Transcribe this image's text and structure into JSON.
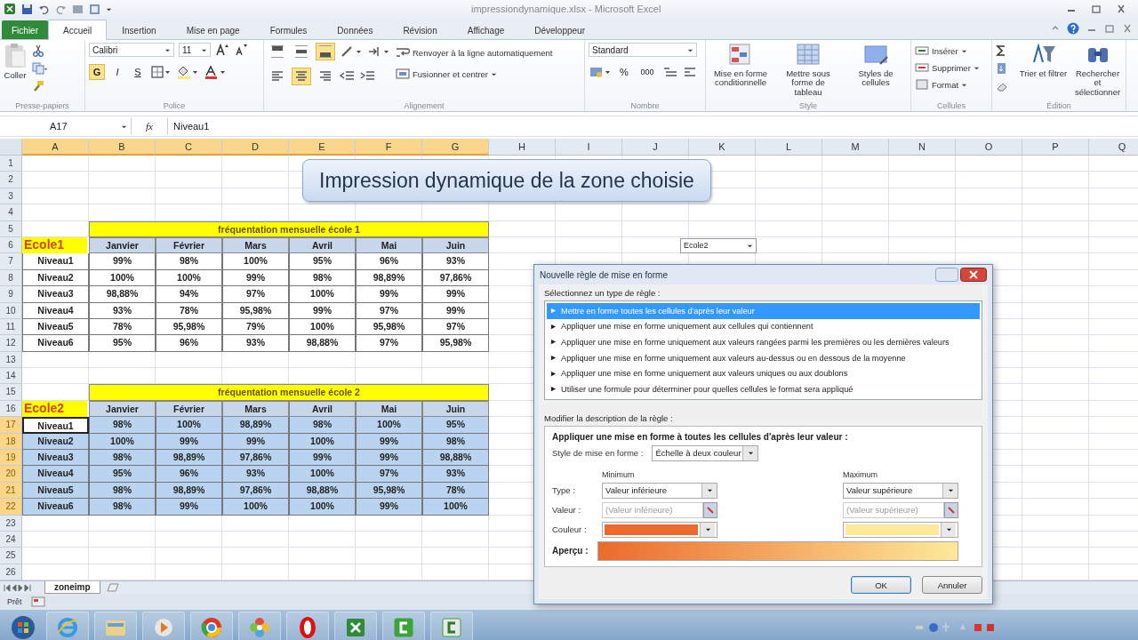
{
  "window": {
    "title": "impressiondynamique.xlsx - Microsoft Excel"
  },
  "tabs": [
    {
      "label": "Fichier",
      "kind": "file",
      "selected": false
    },
    {
      "label": "Accueil",
      "kind": "tab",
      "selected": true
    },
    {
      "label": "Insertion",
      "kind": "tab",
      "selected": false
    },
    {
      "label": "Mise en page",
      "kind": "tab",
      "selected": false
    },
    {
      "label": "Formules",
      "kind": "tab",
      "selected": false
    },
    {
      "label": "Données",
      "kind": "tab",
      "selected": false
    },
    {
      "label": "Révision",
      "kind": "tab",
      "selected": false
    },
    {
      "label": "Affichage",
      "kind": "tab",
      "selected": false
    },
    {
      "label": "Développeur",
      "kind": "tab",
      "selected": false
    }
  ],
  "ribbon": {
    "clipboard": {
      "label": "Presse-papiers",
      "paste": "Coller"
    },
    "font": {
      "label": "Police",
      "name": "Calibri",
      "size": "11",
      "styles": [
        {
          "label": "G",
          "kind": "bold",
          "selected": true
        },
        {
          "label": "I",
          "kind": "italic",
          "selected": false
        },
        {
          "label": "S",
          "kind": "underline",
          "selected": false
        }
      ]
    },
    "alignment": {
      "label": "Alignement",
      "vertical": [
        {
          "kind": "top",
          "selected": false
        },
        {
          "kind": "middle",
          "selected": false
        },
        {
          "kind": "bottom",
          "selected": true
        }
      ],
      "horizontal": [
        {
          "kind": "left",
          "selected": false
        },
        {
          "kind": "center",
          "selected": true
        },
        {
          "kind": "right",
          "selected": false
        }
      ],
      "wrap": "Renvoyer à la ligne automatiquement",
      "merge": "Fusionner et centrer"
    },
    "number": {
      "label": "Nombre",
      "format": "Standard",
      "percent": "%",
      "thousands": "000"
    },
    "style": {
      "label": "Style",
      "buttons": [
        "Mise en forme conditionnelle",
        "Mettre sous forme de tableau",
        "Styles de cellules"
      ]
    },
    "cells": {
      "label": "Cellules",
      "buttons": [
        "Insérer",
        "Supprimer",
        "Format"
      ]
    },
    "editing": {
      "label": "Édition",
      "buttons": [
        "Trier et filtrer",
        "Rechercher et sélectionner"
      ]
    }
  },
  "formula_bar": {
    "name_box": "A17",
    "fx": "fx",
    "value": "Niveau1"
  },
  "sheet": {
    "columns": [
      {
        "label": "A",
        "selected": true
      },
      {
        "label": "B",
        "selected": true
      },
      {
        "label": "C",
        "selected": true
      },
      {
        "label": "D",
        "selected": true
      },
      {
        "label": "E",
        "selected": true
      },
      {
        "label": "F",
        "selected": true
      },
      {
        "label": "G",
        "selected": true
      },
      {
        "label": "H",
        "selected": false
      },
      {
        "label": "I",
        "selected": false
      },
      {
        "label": "J",
        "selected": false
      },
      {
        "label": "K",
        "selected": false
      },
      {
        "label": "L",
        "selected": false
      },
      {
        "label": "M",
        "selected": false
      },
      {
        "label": "N",
        "selected": false
      },
      {
        "label": "O",
        "selected": false
      },
      {
        "label": "P",
        "selected": false
      },
      {
        "label": "Q",
        "selected": false
      }
    ],
    "row_numbers": [
      {
        "label": "1",
        "selected": false
      },
      {
        "label": "2",
        "selected": false
      },
      {
        "label": "3",
        "selected": false
      },
      {
        "label": "4",
        "selected": false
      },
      {
        "label": "5",
        "selected": false
      },
      {
        "label": "6",
        "selected": false
      },
      {
        "label": "7",
        "selected": false
      },
      {
        "label": "8",
        "selected": false
      },
      {
        "label": "9",
        "selected": false
      },
      {
        "label": "10",
        "selected": false
      },
      {
        "label": "11",
        "selected": false
      },
      {
        "label": "12",
        "selected": false
      },
      {
        "label": "13",
        "selected": false
      },
      {
        "label": "14",
        "selected": false
      },
      {
        "label": "15",
        "selected": false
      },
      {
        "label": "16",
        "selected": false
      },
      {
        "label": "17",
        "selected": true
      },
      {
        "label": "18",
        "selected": true
      },
      {
        "label": "19",
        "selected": true
      },
      {
        "label": "20",
        "selected": true
      },
      {
        "label": "21",
        "selected": true
      },
      {
        "label": "22",
        "selected": true
      },
      {
        "label": "23",
        "selected": false
      },
      {
        "label": "24",
        "selected": false
      },
      {
        "label": "25",
        "selected": false
      },
      {
        "label": "26",
        "selected": false
      }
    ],
    "title_shape": "Impression dynamique de la zone choisie",
    "selector": {
      "value": "Ecole2"
    },
    "tables": [
      {
        "title": "fréquentation mensuelle école 1",
        "school": "Ecole1",
        "months": [
          "Janvier",
          "Février",
          "Mars",
          "Avril",
          "Mai",
          "Juin"
        ],
        "rows": [
          {
            "label": "Niveau1",
            "selected": false,
            "active": false,
            "values": [
              "99%",
              "98%",
              "100%",
              "95%",
              "96%",
              "93%"
            ]
          },
          {
            "label": "Niveau2",
            "selected": false,
            "active": false,
            "values": [
              "100%",
              "100%",
              "99%",
              "98%",
              "98,89%",
              "97,86%"
            ]
          },
          {
            "label": "Niveau3",
            "selected": false,
            "active": false,
            "values": [
              "98,88%",
              "94%",
              "97%",
              "100%",
              "99%",
              "99%"
            ]
          },
          {
            "label": "Niveau4",
            "selected": false,
            "active": false,
            "values": [
              "93%",
              "78%",
              "95,98%",
              "99%",
              "97%",
              "99%"
            ]
          },
          {
            "label": "Niveau5",
            "selected": false,
            "active": false,
            "values": [
              "78%",
              "95,98%",
              "79%",
              "100%",
              "95,98%",
              "97%"
            ]
          },
          {
            "label": "Niveau6",
            "selected": false,
            "active": false,
            "values": [
              "95%",
              "96%",
              "93%",
              "98,88%",
              "97%",
              "95,98%"
            ]
          }
        ]
      },
      {
        "title": "fréquentation mensuelle école 2",
        "school": "Ecole2",
        "months": [
          "Janvier",
          "Février",
          "Mars",
          "Avril",
          "Mai",
          "Juin"
        ],
        "rows": [
          {
            "label": "Niveau1",
            "selected": true,
            "active": true,
            "values": [
              "98%",
              "100%",
              "98,89%",
              "98%",
              "100%",
              "95%"
            ]
          },
          {
            "label": "Niveau2",
            "selected": true,
            "active": false,
            "values": [
              "100%",
              "99%",
              "99%",
              "100%",
              "99%",
              "98%"
            ]
          },
          {
            "label": "Niveau3",
            "selected": true,
            "active": false,
            "values": [
              "98%",
              "98,89%",
              "97,86%",
              "99%",
              "99%",
              "98,88%"
            ]
          },
          {
            "label": "Niveau4",
            "selected": true,
            "active": false,
            "values": [
              "95%",
              "96%",
              "93%",
              "100%",
              "97%",
              "93%"
            ]
          },
          {
            "label": "Niveau5",
            "selected": true,
            "active": false,
            "values": [
              "98%",
              "98,89%",
              "97,86%",
              "98,88%",
              "95,98%",
              "78%"
            ]
          },
          {
            "label": "Niveau6",
            "selected": true,
            "active": false,
            "values": [
              "98%",
              "99%",
              "100%",
              "100%",
              "99%",
              "100%"
            ]
          }
        ]
      }
    ]
  },
  "sheet_tabs": [
    {
      "label": "zoneimp",
      "selected": true
    }
  ],
  "status_bar": {
    "text": "Prêt"
  },
  "dialog": {
    "title": "Nouvelle règle de mise en forme",
    "select_label": "Sélectionnez un type de règle :",
    "rules": [
      {
        "label": "Mettre en forme toutes les cellules d'après leur valeur",
        "selected": true
      },
      {
        "label": "Appliquer une mise en forme uniquement aux cellules qui contiennent",
        "selected": false
      },
      {
        "label": "Appliquer une mise en forme uniquement aux valeurs rangées parmi les premières ou les dernières valeurs",
        "selected": false
      },
      {
        "label": "Appliquer une mise en forme uniquement aux valeurs au-dessus ou en dessous de la moyenne",
        "selected": false
      },
      {
        "label": "Appliquer une mise en forme uniquement aux valeurs uniques ou aux doublons",
        "selected": false
      },
      {
        "label": "Utiliser une formule pour déterminer pour quelles cellules le format sera appliqué",
        "selected": false
      }
    ],
    "edit_label": "Modifier la description de la règle :",
    "heading": "Appliquer une mise en forme à toutes les cellules d'après leur valeur :",
    "style_label": "Style de mise en forme :",
    "style_value": "Échelle à deux couleur",
    "minimum": {
      "title": "Minimum",
      "type": "Valeur inférieure",
      "value_placeholder": "(Valeur inférieure)",
      "color": "#ec6a2c"
    },
    "maximum": {
      "title": "Maximum",
      "type": "Valeur supérieure",
      "value_placeholder": "(Valeur supérieure)",
      "color": "#fde99a"
    },
    "type_label": "Type :",
    "value_label": "Valeur :",
    "color_label": "Couleur :",
    "preview_label": "Aperçu :",
    "buttons": [
      {
        "label": "OK",
        "kind": "default"
      },
      {
        "label": "Annuler",
        "kind": "normal"
      }
    ]
  }
}
